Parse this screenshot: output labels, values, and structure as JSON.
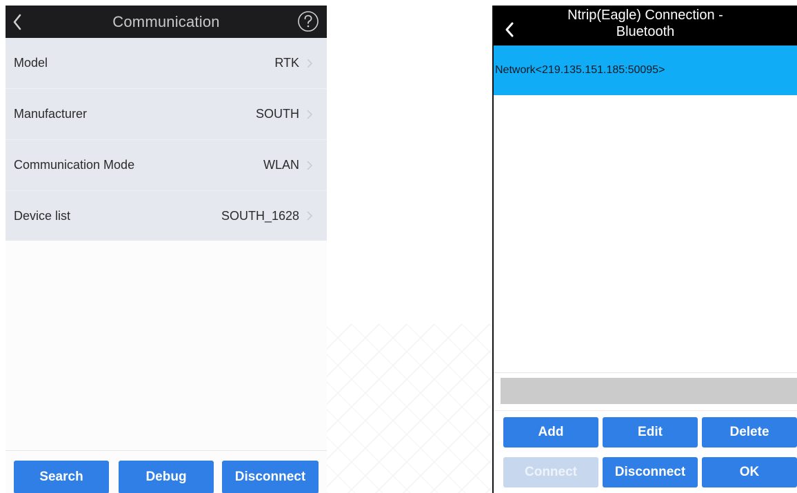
{
  "left_screen": {
    "title": "Communication",
    "rows": [
      {
        "label": "Model",
        "value": "RTK"
      },
      {
        "label": "Manufacturer",
        "value": "SOUTH"
      },
      {
        "label": "Communication Mode",
        "value": "WLAN"
      },
      {
        "label": "Device list",
        "value": "SOUTH_1628"
      }
    ],
    "buttons": {
      "search": "Search",
      "debug": "Debug",
      "disconnect": "Disconnect"
    }
  },
  "right_screen": {
    "title_line1": "Ntrip(Eagle) Connection -",
    "title_line2": "Bluetooth",
    "list": [
      {
        "label": "Network<219.135.151.185:50095>",
        "selected": true
      }
    ],
    "buttons": {
      "add": "Add",
      "edit": "Edit",
      "delete": "Delete",
      "connect": "Connect",
      "disconnect": "Disconnect",
      "ok": "OK"
    }
  },
  "colors": {
    "accent_blue": "#2f7fe6",
    "selected_row": "#10acf5",
    "topbar": "#1c1c1e",
    "row_bg": "#e6e8f0",
    "disabled_button": "#c7d7ee"
  }
}
